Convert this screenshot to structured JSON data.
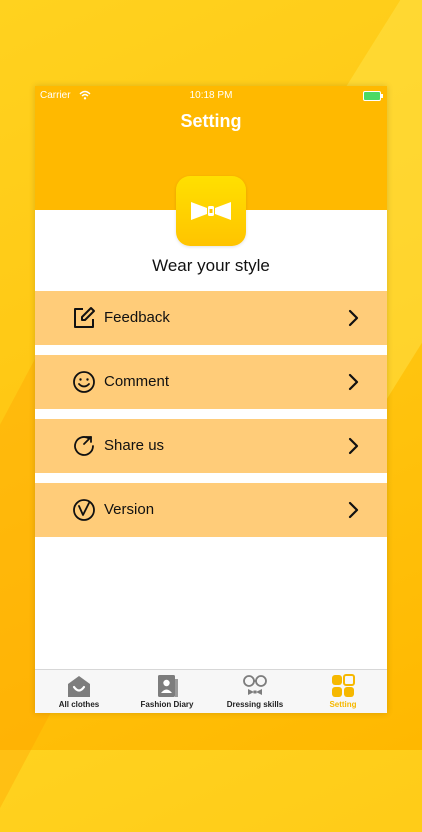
{
  "status_bar": {
    "carrier": "Carrier",
    "time": "10:18 PM"
  },
  "header": {
    "title": "Setting"
  },
  "app": {
    "tagline": "Wear your style"
  },
  "menu": [
    {
      "label": "Feedback",
      "icon": "edit-icon"
    },
    {
      "label": "Comment",
      "icon": "smile-icon"
    },
    {
      "label": "Share us",
      "icon": "share-icon"
    },
    {
      "label": "Version",
      "icon": "version-icon"
    }
  ],
  "tabs": [
    {
      "label": "All clothes",
      "icon": "wardrobe-icon"
    },
    {
      "label": "Fashion Diary",
      "icon": "diary-icon"
    },
    {
      "label": "Dressing skills",
      "icon": "glasses-bowtie-icon"
    },
    {
      "label": "Setting",
      "icon": "grid-icon",
      "active": true
    }
  ],
  "colors": {
    "accent": "#ffb900",
    "menu_bg": "#ffcc79",
    "active_tab": "#f6b800"
  }
}
